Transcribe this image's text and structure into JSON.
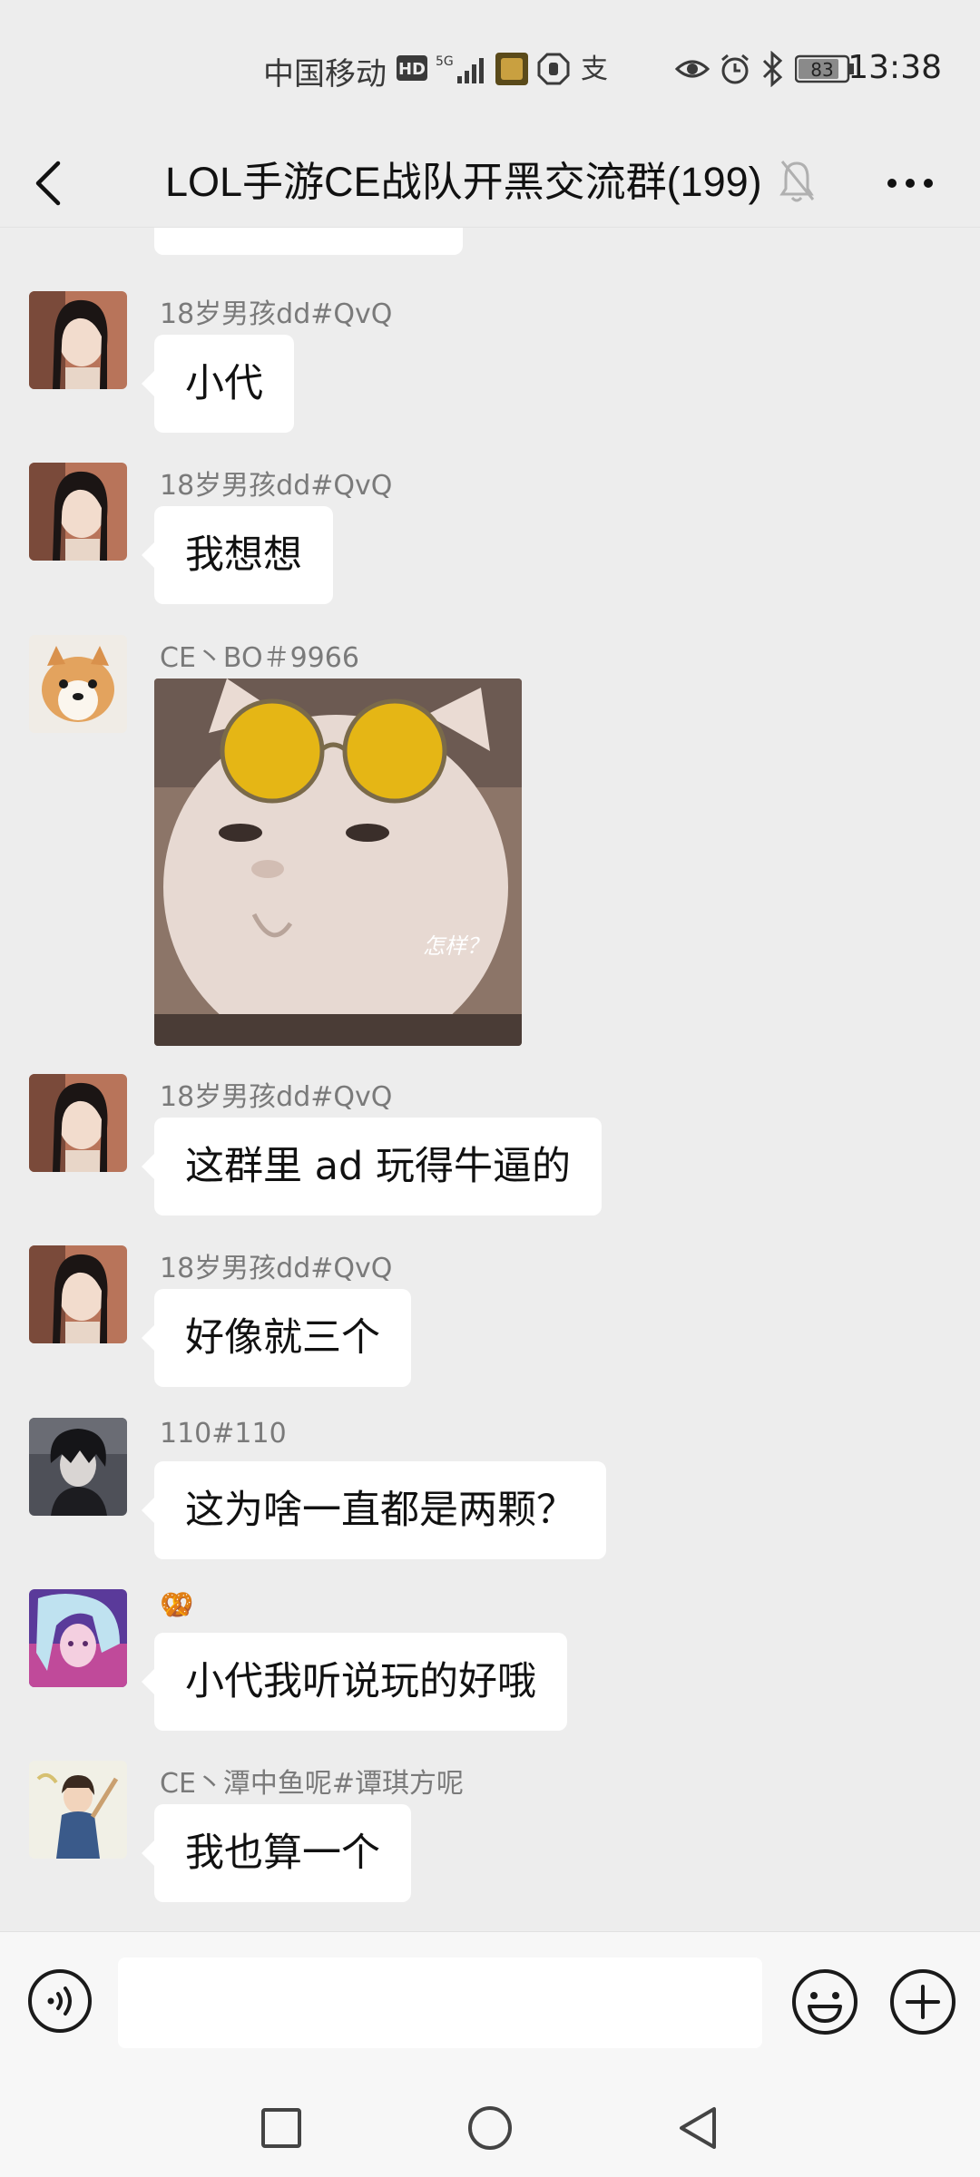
{
  "status_bar": {
    "carrier": "中国移动",
    "hd_badge": "HD",
    "network": "5G",
    "battery": "83",
    "time": "13:38"
  },
  "header": {
    "title": "LOL手游CE战队开黑交流群(199)",
    "icons": [
      "back-icon",
      "mute-bell-icon",
      "more-icon"
    ]
  },
  "messages": [
    {
      "sender": "18岁男孩dd#QvQ",
      "text": "小代"
    },
    {
      "sender": "18岁男孩dd#QvQ",
      "text": "我想想"
    },
    {
      "sender": "CE丶BO＃9966",
      "sticker_caption": "怎样？"
    },
    {
      "sender": "18岁男孩dd#QvQ",
      "text": "这群里 ad 玩得牛逼的"
    },
    {
      "sender": "18岁男孩dd#QvQ",
      "text": "好像就三个"
    },
    {
      "sender": "110#110",
      "text": "这为啥一直都是两颗？"
    },
    {
      "sender": "🥨",
      "text": "小代我听说玩的好哦"
    },
    {
      "sender": "CE丶潭中鱼呢#谭琪方呢",
      "text": "我也算一个"
    }
  ],
  "input_bar": {
    "placeholder": "",
    "icons": [
      "voice-icon",
      "emoji-icon",
      "plus-icon"
    ]
  },
  "nav_bar": {
    "icons": [
      "recent-apps-icon",
      "home-icon",
      "back-nav-icon"
    ]
  },
  "colors": {
    "background": "#ededed",
    "bubble": "#ffffff",
    "sender_name": "#7a7a7a"
  }
}
